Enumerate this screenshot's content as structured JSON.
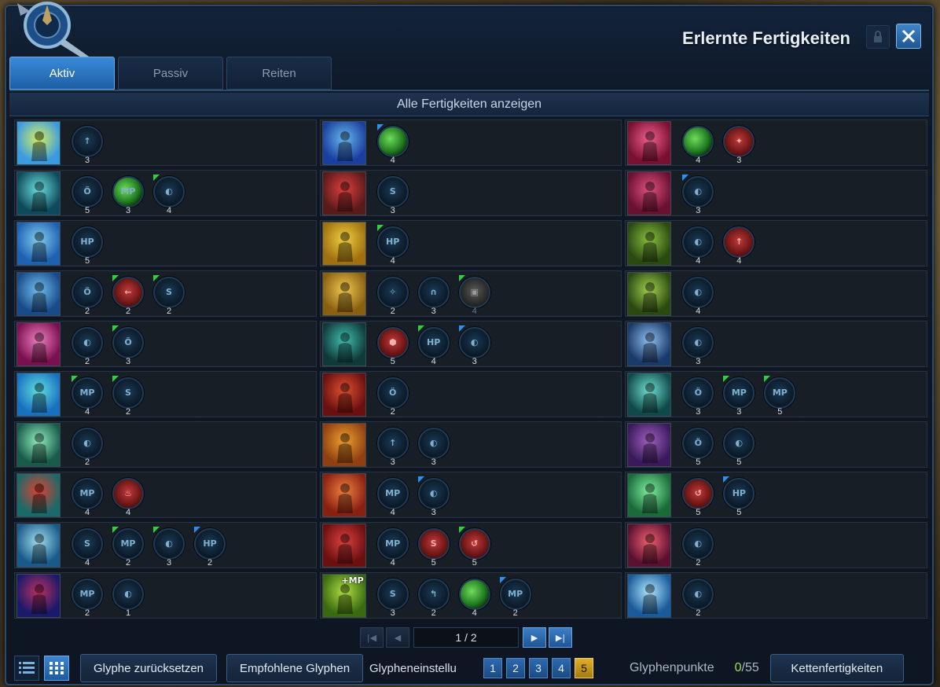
{
  "window": {
    "title": "Erlernte Fertigkeiten",
    "lock_icon": "lock-icon",
    "close_icon": "close-icon"
  },
  "tabs": [
    {
      "label": "Aktiv",
      "active": true
    },
    {
      "label": "Passiv",
      "active": false
    },
    {
      "label": "Reiten",
      "active": false
    }
  ],
  "show_all_label": "Alle Fertigkeiten anzeigen",
  "skills": [
    [
      {
        "icon": "lightning-burst-icon",
        "c1": "#3a9be0",
        "c2": "#d8f060",
        "glyphs": [
          {
            "sym": "↑",
            "lvl": "3"
          }
        ]
      },
      {
        "icon": "vortex-icon",
        "c1": "#1a3fa0",
        "c2": "#6ab8f0",
        "glyphs": [
          {
            "sym": "",
            "type": "green",
            "corner": "b",
            "lvl": "4"
          }
        ]
      },
      {
        "icon": "meteor-rain-icon",
        "c1": "#7a1030",
        "c2": "#f06090",
        "glyphs": [
          {
            "sym": "",
            "type": "green",
            "lvl": "4"
          },
          {
            "sym": "✦",
            "type": "red",
            "lvl": "3"
          }
        ]
      }
    ],
    [
      {
        "icon": "spirit-aura-icon",
        "c1": "#0f4a5a",
        "c2": "#6ae0e0",
        "glyphs": [
          {
            "sym": "Ö",
            "lvl": "5"
          },
          {
            "sym": "MP",
            "type": "green",
            "lvl": "3"
          },
          {
            "sym": "◐",
            "corner": "g",
            "lvl": "4"
          }
        ]
      },
      {
        "icon": "target-mark-icon",
        "c1": "#5a1a1a",
        "c2": "#e04040",
        "glyphs": [
          {
            "sym": "S",
            "lvl": "3"
          }
        ]
      },
      {
        "icon": "crimson-strike-icon",
        "c1": "#6a1030",
        "c2": "#e05080",
        "glyphs": [
          {
            "sym": "◐",
            "corner": "b",
            "lvl": "3"
          }
        ]
      }
    ],
    [
      {
        "icon": "water-palm-icon",
        "c1": "#2060b0",
        "c2": "#80d0f0",
        "glyphs": [
          {
            "sym": "HP",
            "lvl": "5"
          }
        ]
      },
      {
        "icon": "golden-body-icon",
        "c1": "#a07010",
        "c2": "#f0d040",
        "glyphs": [
          {
            "sym": "HP",
            "corner": "g",
            "lvl": "4"
          }
        ]
      },
      {
        "icon": "earth-guard-icon",
        "c1": "#2a4a10",
        "c2": "#8ac040",
        "glyphs": [
          {
            "sym": "◐",
            "lvl": "4"
          },
          {
            "sym": "↑",
            "type": "red",
            "lvl": "4"
          }
        ]
      }
    ],
    [
      {
        "icon": "shield-sigil-icon",
        "c1": "#1a4a8a",
        "c2": "#70c0f0",
        "glyphs": [
          {
            "sym": "Ö",
            "lvl": "2"
          },
          {
            "sym": "←",
            "type": "red",
            "corner": "g",
            "lvl": "2"
          },
          {
            "sym": "S",
            "corner": "g",
            "lvl": "2"
          }
        ]
      },
      {
        "icon": "golden-trio-icon",
        "c1": "#8a6010",
        "c2": "#f0c850",
        "glyphs": [
          {
            "sym": "✧",
            "lvl": "2"
          },
          {
            "sym": "∩",
            "lvl": "3"
          },
          {
            "sym": "▣",
            "type": "gray",
            "corner": "g",
            "lvl": "4",
            "dim": true
          }
        ]
      },
      {
        "icon": "nature-warrior-icon",
        "c1": "#2a4a10",
        "c2": "#a0d050",
        "glyphs": [
          {
            "sym": "◐",
            "lvl": "4"
          }
        ]
      }
    ],
    [
      {
        "icon": "pink-pillar-icon",
        "c1": "#7a1050",
        "c2": "#f080c0",
        "glyphs": [
          {
            "sym": "◐",
            "lvl": "2"
          },
          {
            "sym": "Ö",
            "corner": "g",
            "lvl": "3"
          }
        ]
      },
      {
        "icon": "shadow-gate-icon",
        "c1": "#103a3a",
        "c2": "#40c0b0",
        "glyphs": [
          {
            "sym": "⬢",
            "type": "red",
            "lvl": "5"
          },
          {
            "sym": "HP",
            "corner": "g",
            "lvl": "4"
          },
          {
            "sym": "◐",
            "corner": "b",
            "lvl": "3"
          }
        ]
      },
      {
        "icon": "sleep-icon",
        "c1": "#1a3a6a",
        "c2": "#90c0f0",
        "glyphs": [
          {
            "sym": "◐",
            "lvl": "3"
          }
        ]
      }
    ],
    [
      {
        "icon": "heal-cross-icon",
        "c1": "#1a70c0",
        "c2": "#60e0e0",
        "glyphs": [
          {
            "sym": "MP",
            "corner": "g",
            "lvl": "4"
          },
          {
            "sym": "S",
            "corner": "g",
            "lvl": "2"
          }
        ]
      },
      {
        "icon": "fire-dash-icon",
        "c1": "#6a1010",
        "c2": "#e05030",
        "glyphs": [
          {
            "sym": "Ö",
            "lvl": "2"
          }
        ]
      },
      {
        "icon": "chain-grasp-icon",
        "c1": "#0f4a4a",
        "c2": "#70e0d0",
        "glyphs": [
          {
            "sym": "Ö",
            "lvl": "3"
          },
          {
            "sym": "MP",
            "corner": "g",
            "lvl": "3"
          },
          {
            "sym": "MP",
            "corner": "g",
            "lvl": "5"
          }
        ]
      }
    ],
    [
      {
        "icon": "healing-group-icon",
        "c1": "#1a5a4a",
        "c2": "#90f0c0",
        "glyphs": [
          {
            "sym": "◐",
            "lvl": "2"
          }
        ]
      },
      {
        "icon": "flame-knockback-icon",
        "c1": "#904010",
        "c2": "#f0a030",
        "glyphs": [
          {
            "sym": "↑",
            "lvl": "3"
          },
          {
            "sym": "◐",
            "lvl": "3"
          }
        ]
      },
      {
        "icon": "dark-twins-icon",
        "c1": "#3a1a5a",
        "c2": "#a060c0",
        "glyphs": [
          {
            "sym": "Ö",
            "lvl": "5"
          },
          {
            "sym": "◐",
            "lvl": "5"
          }
        ]
      }
    ],
    [
      {
        "icon": "blast-spark-icon",
        "c1": "#1a6a6a",
        "c2": "#e04030",
        "glyphs": [
          {
            "sym": "MP",
            "lvl": "4"
          },
          {
            "sym": "♨",
            "type": "red",
            "lvl": "4"
          }
        ]
      },
      {
        "icon": "explosion-icon",
        "c1": "#8a2010",
        "c2": "#f08040",
        "glyphs": [
          {
            "sym": "MP",
            "lvl": "4"
          },
          {
            "sym": "◐",
            "corner": "b",
            "lvl": "3"
          }
        ]
      },
      {
        "icon": "green-swirl-icon",
        "c1": "#1a6a3a",
        "c2": "#80f0a0",
        "glyphs": [
          {
            "sym": "↺",
            "type": "red",
            "lvl": "5"
          },
          {
            "sym": "HP",
            "corner": "b",
            "lvl": "5"
          }
        ]
      }
    ],
    [
      {
        "icon": "phoenix-crest-icon",
        "c1": "#1a5a8a",
        "c2": "#a0e0f0",
        "glyphs": [
          {
            "sym": "S",
            "lvl": "4"
          },
          {
            "sym": "MP",
            "corner": "g",
            "lvl": "2"
          },
          {
            "sym": "◐",
            "corner": "g",
            "lvl": "3"
          },
          {
            "sym": "HP",
            "corner": "b",
            "lvl": "2"
          }
        ]
      },
      {
        "icon": "blood-leap-icon",
        "c1": "#6a1010",
        "c2": "#e04040",
        "glyphs": [
          {
            "sym": "MP",
            "lvl": "4"
          },
          {
            "sym": "S",
            "type": "red",
            "lvl": "5"
          },
          {
            "sym": "↺",
            "type": "red",
            "corner": "g",
            "lvl": "5"
          }
        ]
      },
      {
        "icon": "crimson-fall-icon",
        "c1": "#5a1030",
        "c2": "#f06070",
        "glyphs": [
          {
            "sym": "◐",
            "lvl": "2"
          }
        ]
      }
    ],
    [
      {
        "icon": "shadow-pair-icon",
        "c1": "#1a1a6a",
        "c2": "#c03060",
        "glyphs": [
          {
            "sym": "MP",
            "lvl": "2"
          },
          {
            "sym": "◐",
            "lvl": "1"
          }
        ]
      },
      {
        "icon": "mp-runner-icon",
        "c1": "#3a6a10",
        "c2": "#b0e040",
        "badge": "+MP",
        "glyphs": [
          {
            "sym": "S",
            "lvl": "3"
          },
          {
            "sym": "↰",
            "lvl": "2"
          },
          {
            "sym": "",
            "type": "green",
            "lvl": "4"
          },
          {
            "sym": "MP",
            "corner": "b",
            "lvl": "2"
          }
        ]
      },
      {
        "icon": "angel-wings-icon",
        "c1": "#1a5a9a",
        "c2": "#b0e8ff",
        "glyphs": [
          {
            "sym": "◐",
            "lvl": "2"
          }
        ]
      }
    ]
  ],
  "pager": {
    "page": "1 / 2",
    "first_icon": "first-page-icon",
    "prev_icon": "prev-page-icon",
    "next_icon": "next-page-icon",
    "last_icon": "last-page-icon"
  },
  "footer": {
    "list_view_icon": "list-view-icon",
    "grid_view_icon": "grid-view-icon",
    "reset_glyphs": "Glyphe zurücksetzen",
    "recommended_glyphs": "Empfohlene Glyphen",
    "glyph_settings": "Glypheneinstellu",
    "sets": [
      "1",
      "2",
      "3",
      "4",
      "5"
    ],
    "active_set": "5",
    "glyph_points_label": "Glyphenpunkte",
    "glyph_points_current": "0",
    "glyph_points_total": "/55",
    "chain_skills": "Kettenfertigkeiten"
  }
}
